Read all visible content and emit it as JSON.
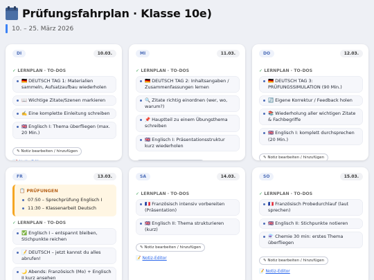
{
  "header": {
    "title": "Prüfungsfahrplan · Klasse 10e)",
    "subtitle": "10. – 25. März 2026"
  },
  "common": {
    "section_label": "LERNPLAN · TO-DOS",
    "note_button": "✎ Notiz bearbeiten / hinzufügen",
    "editor_link": "Notiz-Editor"
  },
  "days": [
    {
      "day": "DI",
      "date": "10.03.",
      "items": [
        "🇩🇪 DEUTSCH TAG 1: Materialien sammeln, Aufsatzaufbau wiederholen",
        "📖 Wichtige Zitate/Szenen markieren",
        "✍️ Eine komplette Einleitung schreiben",
        "🇬🇧 Englisch I: Thema überfliegen (max. 20 Min.)"
      ]
    },
    {
      "day": "MI",
      "date": "11.03.",
      "items": [
        "🇩🇪 DEUTSCH TAG 2: Inhaltsangaben / Zusammenfassungen lernen",
        "🔍 Zitate richtig einordnen (wer, wo, warum?)",
        "📌 Hauptteil zu einem Übungsthema schreiben",
        "🇬🇧 Englisch I: Präsentationsstruktur kurz wiederholen"
      ]
    },
    {
      "day": "DO",
      "date": "12.03.",
      "items": [
        "🇩🇪 DEUTSCH TAG 3: PRÜFUNGSSIMULATION (90 Min.)",
        "🔄 Eigene Korrektur / Feedback holen",
        "📚 Wiederholung aller wichtigen Zitate & Fachbegriffe",
        "🇬🇧 Englisch I: komplett durchsprechen (20 Min.)"
      ]
    },
    {
      "day": "FR",
      "date": "13.03.",
      "exam": {
        "title": "📋 PRÜFUNGEN",
        "items": [
          "07:50 – Sprechprüfung Englisch I",
          "11:30 – Klassenarbeit Deutsch"
        ]
      },
      "items": [
        "✅ Englisch I – entspannt bleiben, Stichpunkte reichen",
        "📝 DEUTSCH – jetzt kannst du alles abrufen!",
        "🌙 Abends: Französisch (Mo) + Englisch II kurz ansehen"
      ]
    },
    {
      "day": "SA",
      "date": "14.03.",
      "items": [
        "🇫🇷 Französisch intensiv vorbereiten (Präsentation)",
        "🇬🇧 Englisch II: Thema strukturieren (kurz)"
      ]
    },
    {
      "day": "SO",
      "date": "15.03.",
      "items": [
        "🇫🇷 Französisch Probedurchlauf (laut sprechen)",
        "🇬🇧 Englisch II: Stichpunkte notieren",
        "⚗️ Chemie 30 min: erstes Thema überfliegen"
      ]
    }
  ]
}
